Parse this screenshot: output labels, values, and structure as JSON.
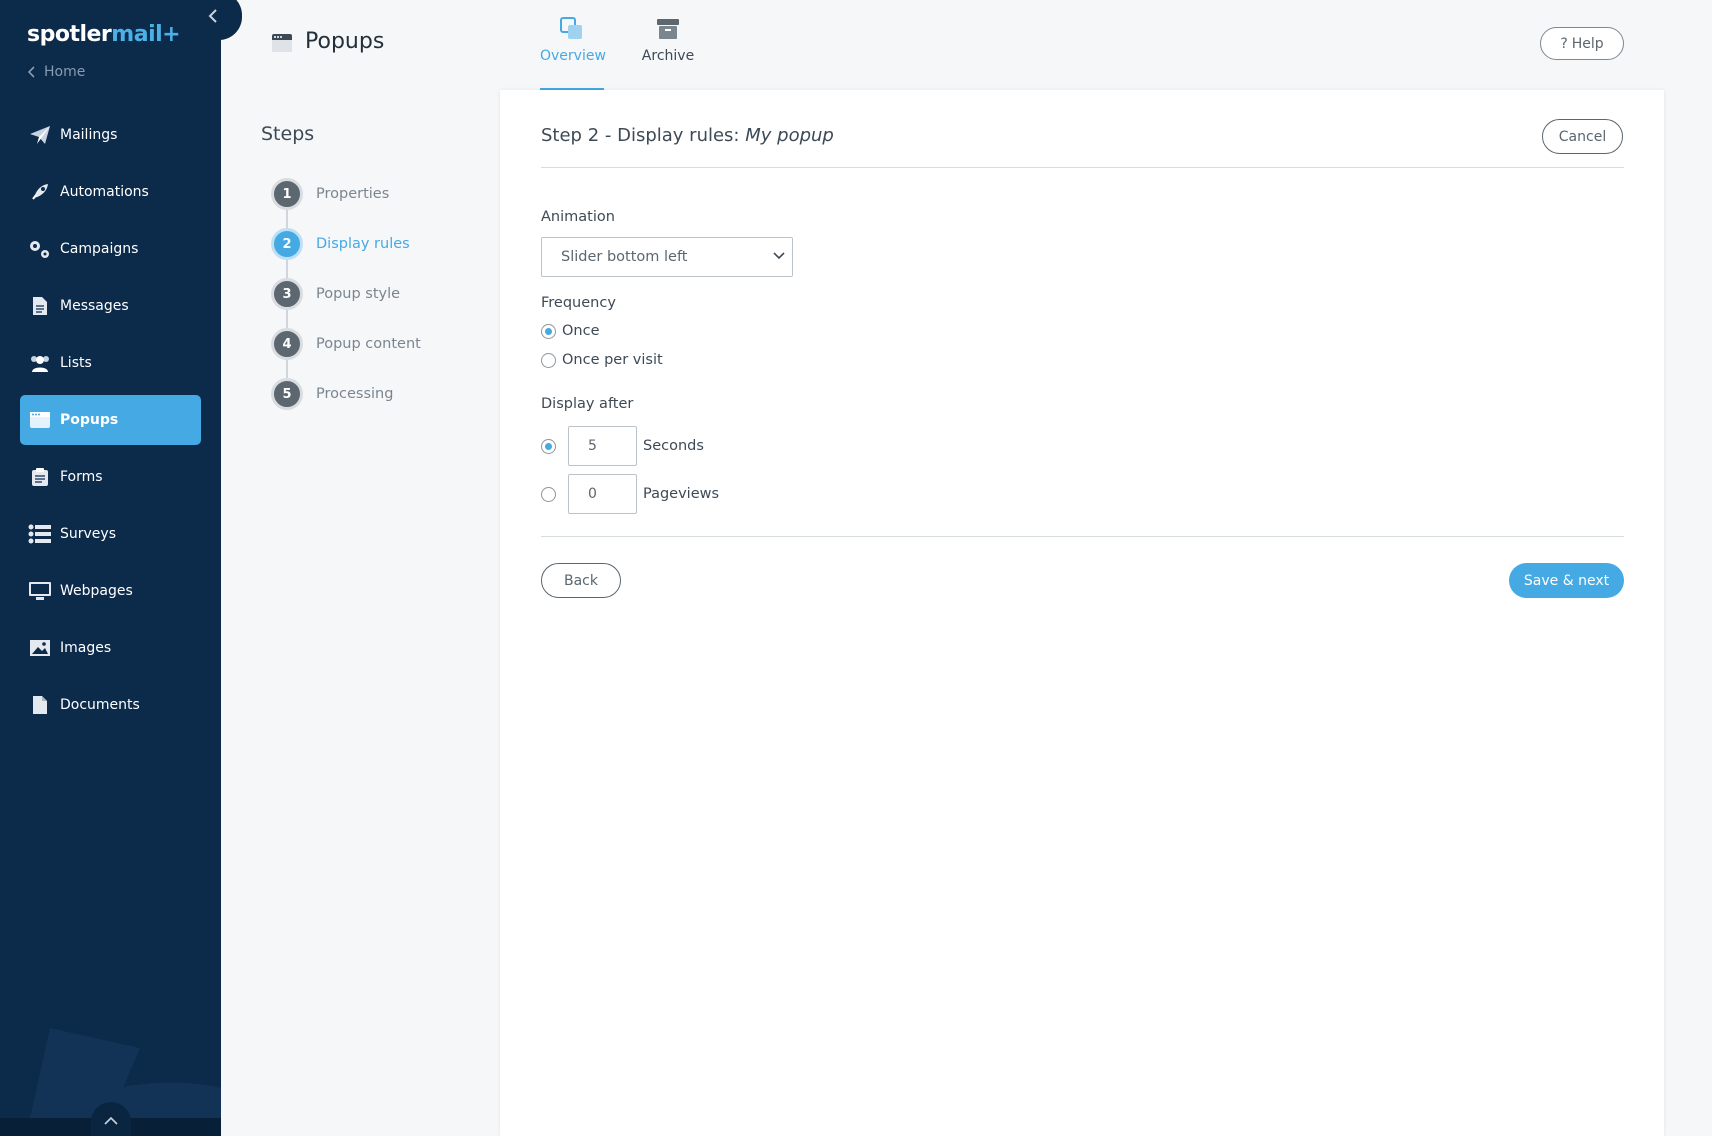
{
  "app": {
    "logo_main": "spotler",
    "logo_accent": "mail+",
    "home_label": "Home"
  },
  "sidebar": {
    "items": [
      {
        "label": "Mailings",
        "icon": "paper-plane-icon"
      },
      {
        "label": "Automations",
        "icon": "rocket-icon"
      },
      {
        "label": "Campaigns",
        "icon": "gears-icon"
      },
      {
        "label": "Messages",
        "icon": "document-icon"
      },
      {
        "label": "Lists",
        "icon": "users-icon"
      },
      {
        "label": "Popups",
        "icon": "popup-window-icon",
        "active": true
      },
      {
        "label": "Forms",
        "icon": "clipboard-icon"
      },
      {
        "label": "Surveys",
        "icon": "survey-list-icon"
      },
      {
        "label": "Webpages",
        "icon": "monitor-icon"
      },
      {
        "label": "Images",
        "icon": "image-icon"
      },
      {
        "label": "Documents",
        "icon": "file-icon"
      }
    ]
  },
  "header": {
    "title": "Popups",
    "tabs": [
      {
        "label": "Overview",
        "active": true
      },
      {
        "label": "Archive"
      }
    ],
    "help_label": "Help"
  },
  "steps": {
    "title": "Steps",
    "items": [
      {
        "number": "1",
        "label": "Properties"
      },
      {
        "number": "2",
        "label": "Display rules",
        "active": true
      },
      {
        "number": "3",
        "label": "Popup style"
      },
      {
        "number": "4",
        "label": "Popup content"
      },
      {
        "number": "5",
        "label": "Processing"
      }
    ]
  },
  "form": {
    "title_prefix": "Step 2 - Display rules:",
    "title_name": "My popup",
    "cancel_label": "Cancel",
    "animation_label": "Animation",
    "animation_value": "Slider bottom left",
    "frequency_label": "Frequency",
    "frequency_options": [
      {
        "label": "Once",
        "checked": true
      },
      {
        "label": "Once per visit",
        "checked": false
      }
    ],
    "display_after_label": "Display after",
    "display_after_options": [
      {
        "value": "5",
        "unit": "Seconds",
        "checked": true
      },
      {
        "value": "0",
        "unit": "Pageviews",
        "checked": false
      }
    ],
    "back_label": "Back",
    "save_label": "Save & next"
  },
  "colors": {
    "sidebar_bg": "#0c2a4a",
    "accent": "#45a9e3",
    "page_bg": "#f6f7f9"
  }
}
